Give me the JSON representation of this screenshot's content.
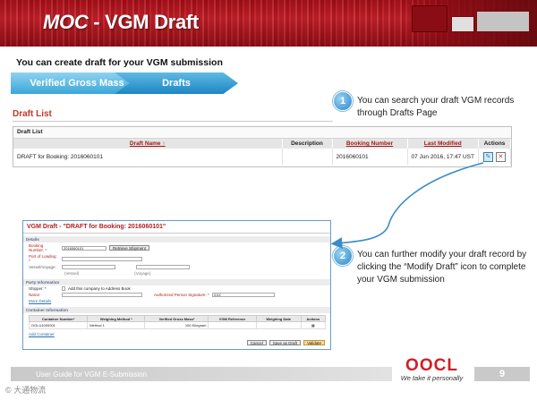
{
  "header": {
    "title_moc": "MOC",
    "title_rest": " - VGM Draft"
  },
  "subtitle": "You can create draft for your VGM submission",
  "steps": [
    "Verified Gross Mass",
    "Drafts"
  ],
  "draft_list_heading": "Draft List",
  "callouts": [
    {
      "number": "1",
      "text": "You can search your draft VGM records through Drafts Page"
    },
    {
      "number": "2",
      "text": "You can further modify your draft record by clicking the “Modify Draft” icon to complete your VGM submission"
    }
  ],
  "list_panel": {
    "title": "Draft List",
    "columns": [
      "Draft Name ↑",
      "Description",
      "Booking Number",
      "Last Modified",
      "Actions"
    ],
    "row": {
      "draft_name": "DRAFT for Booking: 2016060101",
      "description": "",
      "booking_number": "2016060101",
      "last_modified": "07 Jun 2016, 17:47 UST"
    }
  },
  "form": {
    "title": "VGM Draft - \"DRAFT for Booking: 2016060101\"",
    "sections": [
      "Details",
      "Party Information",
      "Container Information"
    ],
    "booking_label": "Booking Number: *",
    "booking_value": "2016060101",
    "booking_button": "Retrieve Shipment",
    "port_label": "Port of Loading: *",
    "vessel_label": "Vessel/Voyage:",
    "vessel_sub": "(Vessel)",
    "voyage_sub": "(Voyage)",
    "shipper_label": "Shipper: *",
    "add_company": "Add this company to Address Book",
    "name_label": "Name:",
    "auth_label": "Authorized Person Signature: *",
    "auth_value": "XXX",
    "more_details": "More Details",
    "ct_columns": [
      "Container Number*",
      "Weighing Method *",
      "Verified Gross Mass*",
      "VGM Reference",
      "Weighing Date",
      "Actions"
    ],
    "ct_row": {
      "container": "OOLU1000001",
      "method": "Method 1",
      "mass": "100",
      "unit": "Kilogram"
    },
    "add_container": "Add Container",
    "buttons": [
      "Cancel",
      "Save as Draft",
      "Validate"
    ]
  },
  "footer": {
    "text": "User Guide for VGM E-Submission",
    "page": "9",
    "logo": "OOCL",
    "tagline": "We take it personally"
  },
  "watermark": "© 大通物流",
  "colors": {
    "brand_red": "#c81e27",
    "step_blue": "#3aa6d8",
    "heading_red": "#c0392b"
  }
}
